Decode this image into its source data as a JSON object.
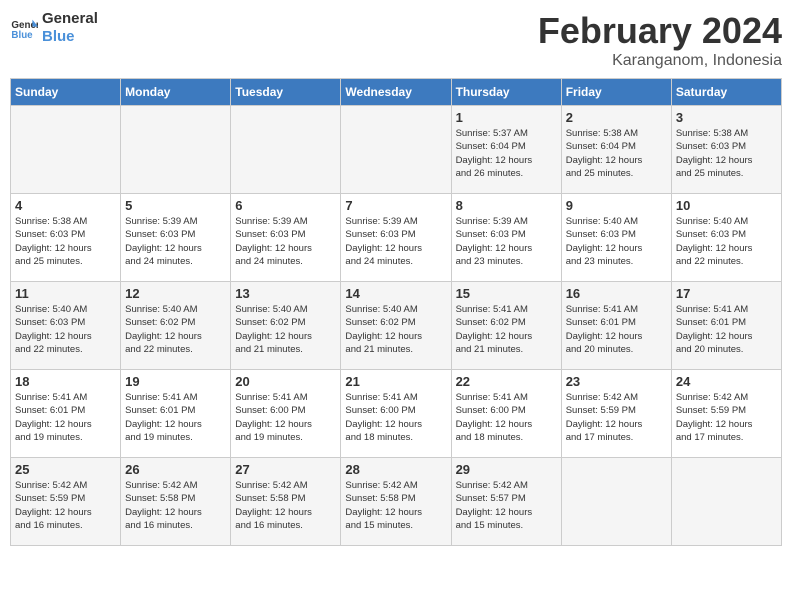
{
  "header": {
    "logo_line1": "General",
    "logo_line2": "Blue",
    "month_year": "February 2024",
    "location": "Karanganom, Indonesia"
  },
  "weekdays": [
    "Sunday",
    "Monday",
    "Tuesday",
    "Wednesday",
    "Thursday",
    "Friday",
    "Saturday"
  ],
  "weeks": [
    [
      {
        "day": "",
        "info": ""
      },
      {
        "day": "",
        "info": ""
      },
      {
        "day": "",
        "info": ""
      },
      {
        "day": "",
        "info": ""
      },
      {
        "day": "1",
        "info": "Sunrise: 5:37 AM\nSunset: 6:04 PM\nDaylight: 12 hours\nand 26 minutes."
      },
      {
        "day": "2",
        "info": "Sunrise: 5:38 AM\nSunset: 6:04 PM\nDaylight: 12 hours\nand 25 minutes."
      },
      {
        "day": "3",
        "info": "Sunrise: 5:38 AM\nSunset: 6:03 PM\nDaylight: 12 hours\nand 25 minutes."
      }
    ],
    [
      {
        "day": "4",
        "info": "Sunrise: 5:38 AM\nSunset: 6:03 PM\nDaylight: 12 hours\nand 25 minutes."
      },
      {
        "day": "5",
        "info": "Sunrise: 5:39 AM\nSunset: 6:03 PM\nDaylight: 12 hours\nand 24 minutes."
      },
      {
        "day": "6",
        "info": "Sunrise: 5:39 AM\nSunset: 6:03 PM\nDaylight: 12 hours\nand 24 minutes."
      },
      {
        "day": "7",
        "info": "Sunrise: 5:39 AM\nSunset: 6:03 PM\nDaylight: 12 hours\nand 24 minutes."
      },
      {
        "day": "8",
        "info": "Sunrise: 5:39 AM\nSunset: 6:03 PM\nDaylight: 12 hours\nand 23 minutes."
      },
      {
        "day": "9",
        "info": "Sunrise: 5:40 AM\nSunset: 6:03 PM\nDaylight: 12 hours\nand 23 minutes."
      },
      {
        "day": "10",
        "info": "Sunrise: 5:40 AM\nSunset: 6:03 PM\nDaylight: 12 hours\nand 22 minutes."
      }
    ],
    [
      {
        "day": "11",
        "info": "Sunrise: 5:40 AM\nSunset: 6:03 PM\nDaylight: 12 hours\nand 22 minutes."
      },
      {
        "day": "12",
        "info": "Sunrise: 5:40 AM\nSunset: 6:02 PM\nDaylight: 12 hours\nand 22 minutes."
      },
      {
        "day": "13",
        "info": "Sunrise: 5:40 AM\nSunset: 6:02 PM\nDaylight: 12 hours\nand 21 minutes."
      },
      {
        "day": "14",
        "info": "Sunrise: 5:40 AM\nSunset: 6:02 PM\nDaylight: 12 hours\nand 21 minutes."
      },
      {
        "day": "15",
        "info": "Sunrise: 5:41 AM\nSunset: 6:02 PM\nDaylight: 12 hours\nand 21 minutes."
      },
      {
        "day": "16",
        "info": "Sunrise: 5:41 AM\nSunset: 6:01 PM\nDaylight: 12 hours\nand 20 minutes."
      },
      {
        "day": "17",
        "info": "Sunrise: 5:41 AM\nSunset: 6:01 PM\nDaylight: 12 hours\nand 20 minutes."
      }
    ],
    [
      {
        "day": "18",
        "info": "Sunrise: 5:41 AM\nSunset: 6:01 PM\nDaylight: 12 hours\nand 19 minutes."
      },
      {
        "day": "19",
        "info": "Sunrise: 5:41 AM\nSunset: 6:01 PM\nDaylight: 12 hours\nand 19 minutes."
      },
      {
        "day": "20",
        "info": "Sunrise: 5:41 AM\nSunset: 6:00 PM\nDaylight: 12 hours\nand 19 minutes."
      },
      {
        "day": "21",
        "info": "Sunrise: 5:41 AM\nSunset: 6:00 PM\nDaylight: 12 hours\nand 18 minutes."
      },
      {
        "day": "22",
        "info": "Sunrise: 5:41 AM\nSunset: 6:00 PM\nDaylight: 12 hours\nand 18 minutes."
      },
      {
        "day": "23",
        "info": "Sunrise: 5:42 AM\nSunset: 5:59 PM\nDaylight: 12 hours\nand 17 minutes."
      },
      {
        "day": "24",
        "info": "Sunrise: 5:42 AM\nSunset: 5:59 PM\nDaylight: 12 hours\nand 17 minutes."
      }
    ],
    [
      {
        "day": "25",
        "info": "Sunrise: 5:42 AM\nSunset: 5:59 PM\nDaylight: 12 hours\nand 16 minutes."
      },
      {
        "day": "26",
        "info": "Sunrise: 5:42 AM\nSunset: 5:58 PM\nDaylight: 12 hours\nand 16 minutes."
      },
      {
        "day": "27",
        "info": "Sunrise: 5:42 AM\nSunset: 5:58 PM\nDaylight: 12 hours\nand 16 minutes."
      },
      {
        "day": "28",
        "info": "Sunrise: 5:42 AM\nSunset: 5:58 PM\nDaylight: 12 hours\nand 15 minutes."
      },
      {
        "day": "29",
        "info": "Sunrise: 5:42 AM\nSunset: 5:57 PM\nDaylight: 12 hours\nand 15 minutes."
      },
      {
        "day": "",
        "info": ""
      },
      {
        "day": "",
        "info": ""
      }
    ]
  ]
}
